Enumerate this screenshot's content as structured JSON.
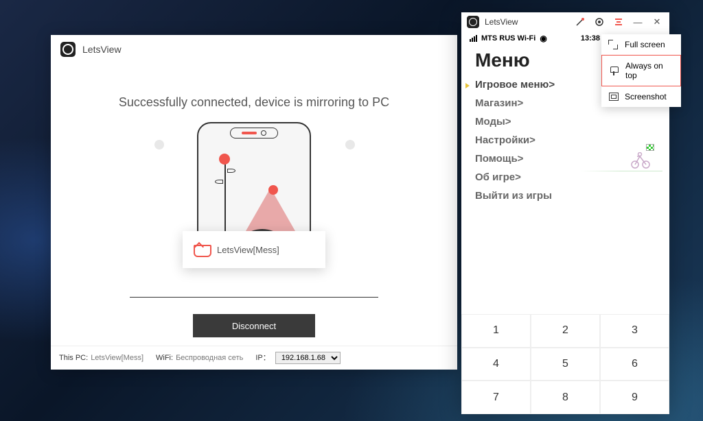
{
  "main": {
    "title": "LetsView",
    "message": "Successfully connected, device is mirroring to PC",
    "device_name": "LetsView[Mess]",
    "disconnect": "Disconnect",
    "footer": {
      "pc_lbl": "This PC:",
      "pc_val": "LetsView[Mess]",
      "wifi_lbl": "WiFi:",
      "wifi_val": "Беспроводная сеть",
      "ip_lbl": "IP：",
      "ip_val": "192.168.1.68"
    }
  },
  "popup": {
    "title": "LetsView",
    "status": {
      "carrier": "MTS RUS Wi-Fi",
      "time": "13:38"
    },
    "menu_title": "Меню",
    "items": [
      {
        "label": "Игровое меню>",
        "active": true
      },
      {
        "label": "Магазин>",
        "active": false
      },
      {
        "label": "Моды>",
        "active": false
      },
      {
        "label": "Настройки>",
        "active": false
      },
      {
        "label": "Помощь>",
        "active": false
      },
      {
        "label": "Об игре>",
        "active": false
      },
      {
        "label": "Выйти из игры",
        "active": false
      }
    ],
    "keypad": [
      "1",
      "2",
      "3",
      "4",
      "5",
      "6",
      "7",
      "8",
      "9"
    ]
  },
  "ctx": {
    "full": "Full screen",
    "top": "Always on top",
    "shot": "Screenshot"
  }
}
